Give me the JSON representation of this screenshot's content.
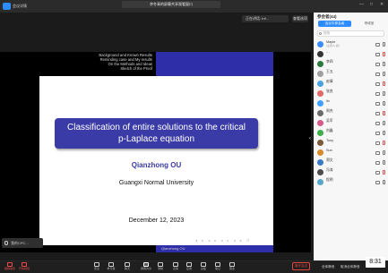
{
  "window": {
    "title": "李冬青的屏幕共享观看窗口",
    "meeting_info": "会议详情",
    "win_controls": [
      "—",
      "□",
      "✕"
    ]
  },
  "share_bar": {
    "speaker": "正在讲话: Inf...",
    "view_option": "查看选项"
  },
  "slide": {
    "nav": [
      "Background and Known Results",
      "Reminding case and My results",
      "On the Methods and Ideas",
      "Sketch of the Proof"
    ],
    "title_line1": "Classification of entire solutions to the critical",
    "title_line2": "p-Laplace equation",
    "author": "Qianzhong OU",
    "affiliation": "Guangxi Normal University",
    "date": "December 12, 2023",
    "footer_label": "Qianzhong OU",
    "beamer_nav": "◂ ▸ ◂ ▸ ◂ ▸ ◂ ▸ ↺"
  },
  "self_video": {
    "label": "我的CPC..."
  },
  "toolbar": {
    "buttons": [
      {
        "label": "解除静音",
        "icon": "mic-icon",
        "red": true
      },
      {
        "label": "开启视频",
        "icon": "video-icon",
        "red": true
      },
      {
        "label": "安全",
        "icon": "shield-icon"
      },
      {
        "label": "参与者",
        "icon": "participants-icon"
      },
      {
        "label": "聊天",
        "icon": "chat-icon"
      },
      {
        "label": "屏幕共享",
        "icon": "share-icon",
        "active": true
      },
      {
        "label": "录制",
        "icon": "record-icon"
      },
      {
        "label": "表情",
        "icon": "emoji-icon"
      },
      {
        "label": "应用",
        "icon": "apps-icon"
      },
      {
        "label": "白板",
        "icon": "whiteboard-icon"
      },
      {
        "label": "笔记",
        "icon": "notes-icon"
      },
      {
        "label": "更多",
        "icon": "more-icon"
      }
    ],
    "leave": "离开会议",
    "right_buttons": [
      "全体静音",
      "取消全体静音",
      "更多"
    ]
  },
  "clock": "8:31",
  "panel": {
    "header": "参会者(44)",
    "tab_active": "会议中参会者",
    "tab_other": "等候室",
    "search_placeholder": "搜索",
    "participants": [
      {
        "name": "Maple",
        "sub": "(主持人,我)",
        "color": "#3b8cff"
      },
      {
        "name": "…",
        "sub": "",
        "color": "#333333"
      },
      {
        "name": "李四",
        "sub": "",
        "color": "#2a7a3c"
      },
      {
        "name": "王五",
        "sub": "",
        "color": "#a0a0a0"
      },
      {
        "name": "赵倩",
        "sub": "",
        "color": "#4aa3df"
      },
      {
        "name": "张良",
        "sub": "",
        "color": "#e46a6a"
      },
      {
        "name": "lin",
        "sub": "",
        "color": "#3fa0ff"
      },
      {
        "name": "周杰",
        "sub": "",
        "color": "#6b6b6b"
      },
      {
        "name": "吴军",
        "sub": "",
        "color": "#d65a8a"
      },
      {
        "name": "刘鑫",
        "sub": "",
        "color": "#3cae4a"
      },
      {
        "name": "Tony",
        "sub": "",
        "color": "#7a5a3a"
      },
      {
        "name": "Sun",
        "sub": "",
        "color": "#d88a2a"
      },
      {
        "name": "郑文",
        "sub": "",
        "color": "#3a7ac8"
      },
      {
        "name": "冯涛",
        "sub": "",
        "color": "#4c4c4c"
      },
      {
        "name": "程明",
        "sub": "",
        "color": "#5aa5c8"
      }
    ]
  }
}
